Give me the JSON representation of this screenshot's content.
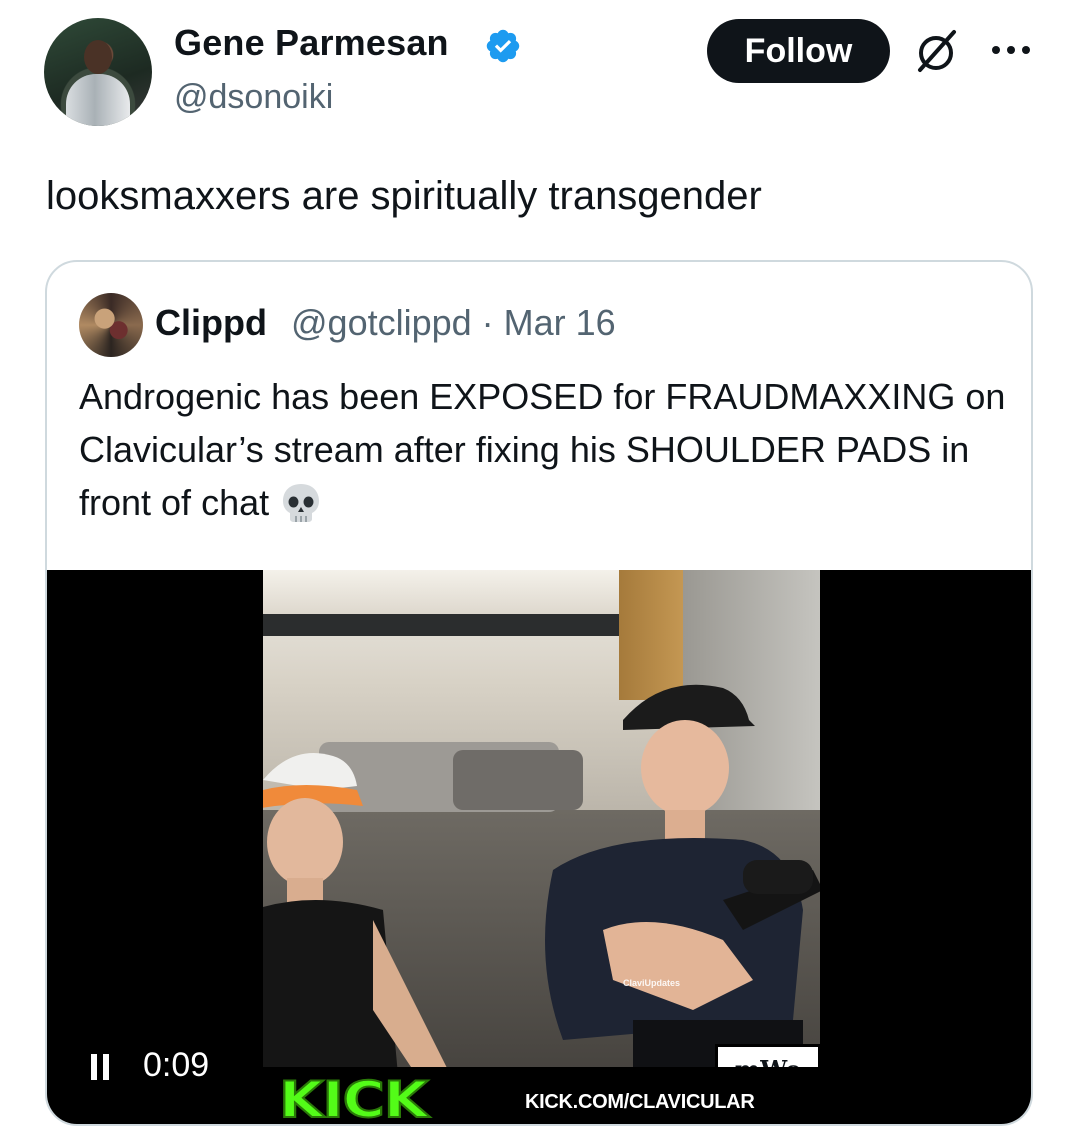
{
  "author": {
    "name": "Gene Parmesan",
    "handle": "@dsonoiki",
    "verified": true,
    "avatar_icon": "profile-photo"
  },
  "actions": {
    "follow_label": "Follow",
    "grok_icon": "grok-icon",
    "more_icon": "more-options-icon"
  },
  "tweet": {
    "text": "looksmaxxers are spiritually transgender"
  },
  "quote": {
    "name": "Clippd",
    "handle_date": "@gotclippd · Mar 16",
    "text": "Androgenic has been EXPOSED for FRAUDMAXXING on Clavicular’s stream after fixing his SHOULDER PADS in front of chat",
    "emoji": "skull-emoji",
    "video": {
      "elapsed": "0:09",
      "state": "playing",
      "overlay_watermark": "ClaviUpdates",
      "kick_logo": "KICK",
      "kick_url": "KICK.COM/CLAVICULAR",
      "corner_logo": "mWo"
    }
  },
  "colors": {
    "text": "#0f1419",
    "secondary": "#536471",
    "verified_blue": "#1d9bf0",
    "border": "#cfd9de",
    "kick_green": "#53fc18"
  }
}
